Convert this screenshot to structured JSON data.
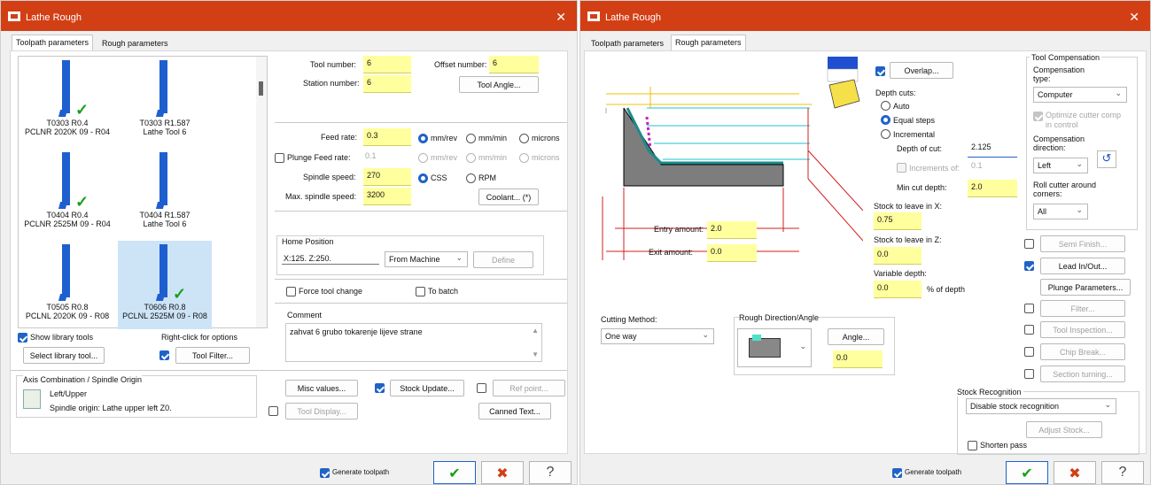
{
  "left": {
    "title": "Lathe Rough",
    "tabs": [
      "Toolpath parameters",
      "Rough parameters"
    ],
    "tools": [
      {
        "line1": "T0303 R0.4",
        "line2": "PCLNR 2020K 09 - R04",
        "checked": true
      },
      {
        "line1": "T0303 R1.587",
        "line2": "Lathe Tool 6",
        "checked": false
      },
      {
        "line1": "T0404 R0.4",
        "line2": "PCLNR 2525M 09 - R04",
        "checked": true
      },
      {
        "line1": "T0404 R1.587",
        "line2": "Lathe Tool 6",
        "checked": false
      },
      {
        "line1": "T0505 R0.8",
        "line2": "PCLNL 2020K 09 - R08",
        "checked": false
      },
      {
        "line1": "T0606 R0.8",
        "line2": "PCLNL 2525M 09 - R08",
        "checked": true
      }
    ],
    "show_library_tools": "Show library tools",
    "right_click_hint": "Right-click for options",
    "select_library_tool": "Select library tool...",
    "tool_filter": "Tool Filter...",
    "axis_group": "Axis Combination / Spindle Origin",
    "axis_line1": "Left/Upper",
    "axis_line2": "Spindle origin: Lathe upper left  Z0.",
    "tool_number_label": "Tool number:",
    "tool_number": "6",
    "offset_number_label": "Offset number:",
    "offset_number": "6",
    "station_number_label": "Station number:",
    "station_number": "6",
    "tool_angle": "Tool Angle...",
    "feed_rate_label": "Feed rate:",
    "feed_rate": "0.3",
    "plunge_feed_label": "Plunge Feed rate:",
    "plunge_feed": "0.1",
    "spindle_speed_label": "Spindle speed:",
    "spindle_speed": "270",
    "max_spindle_label": "Max. spindle speed:",
    "max_spindle": "3200",
    "unit_mmrev": "mm/rev",
    "unit_mmmin": "mm/min",
    "unit_microns": "microns",
    "unit_css": "CSS",
    "unit_rpm": "RPM",
    "coolant": "Coolant... (*)",
    "home_position_label": "Home Position",
    "home_coords": "X:125.  Z:250.",
    "home_mode": "From Machine",
    "define": "Define",
    "force_tool_change": "Force tool change",
    "to_batch": "To batch",
    "comment_label": "Comment",
    "comment": "zahvat 6 grubo tokarenje lijeve strane",
    "misc_values": "Misc values...",
    "stock_update": "Stock Update...",
    "ref_point": "Ref point...",
    "tool_display": "Tool Display...",
    "canned_text": "Canned Text...",
    "generate_toolpath": "Generate toolpath"
  },
  "right": {
    "title": "Lathe Rough",
    "tabs": [
      "Toolpath parameters",
      "Rough parameters"
    ],
    "overlap": "Overlap...",
    "depth_cuts_label": "Depth cuts:",
    "auto": "Auto",
    "equal_steps": "Equal steps",
    "incremental": "Incremental",
    "depth_of_cut_label": "Depth of cut:",
    "depth_of_cut": "2.125",
    "increments_of_label": "Increments of:",
    "increments_of": "0.1",
    "min_cut_depth_label": "Min cut depth:",
    "min_cut_depth": "2.0",
    "stock_x_label": "Stock to leave in X:",
    "stock_x": "0.75",
    "stock_z_label": "Stock to leave in Z:",
    "stock_z": "0.0",
    "variable_depth_label": "Variable depth:",
    "variable_depth": "0.0",
    "pct_of_depth": "% of depth",
    "entry_amount_label": "Entry amount:",
    "entry_amount": "2.0",
    "exit_amount_label": "Exit amount:",
    "exit_amount": "0.0",
    "tool_comp_group": "Tool Compensation",
    "comp_type_label": "Compensation type:",
    "comp_type": "Computer",
    "optimize_cutter": "Optimize cutter comp in control",
    "comp_direction_label": "Compensation direction:",
    "comp_direction": "Left",
    "roll_cutter_label": "Roll cutter around corners:",
    "roll_cutter": "All",
    "semi_finish": "Semi Finish...",
    "lead_inout": "Lead In/Out...",
    "plunge_params": "Plunge Parameters...",
    "filter": "Filter...",
    "tool_inspection": "Tool Inspection...",
    "chip_break": "Chip Break...",
    "section_turning": "Section turning...",
    "cutting_method_label": "Cutting Method:",
    "cutting_method": "One way",
    "rough_dir_label": "Rough Direction/Angle",
    "angle_btn": "Angle...",
    "angle_value": "0.0",
    "stock_recog_label": "Stock Recognition",
    "stock_recog": "Disable stock recognition",
    "adjust_stock": "Adjust Stock...",
    "shorten_pass": "Shorten pass",
    "generate_toolpath": "Generate toolpath"
  },
  "colors": {
    "title_bar": "#d23f15",
    "input_yellow": "#ffff9e",
    "accent_blue": "#1f63c7",
    "ok_green": "#18a018",
    "cancel_red": "#d23f15"
  }
}
